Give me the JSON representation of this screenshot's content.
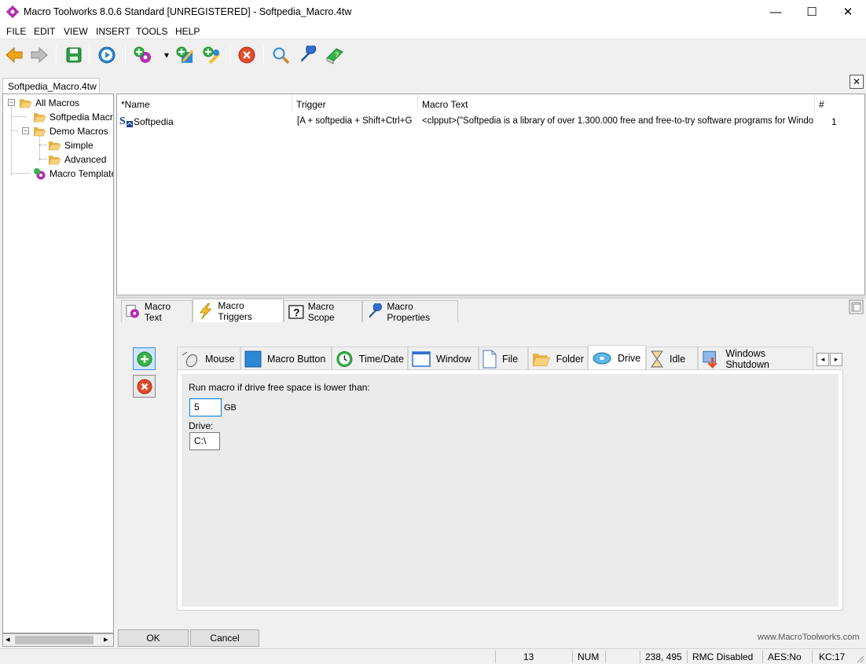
{
  "window": {
    "title": "Macro Toolworks 8.0.6 Standard [UNREGISTERED] - Softpedia_Macro.4tw",
    "minimize_glyph": "—",
    "maximize_glyph": "☐",
    "close_glyph": "✕"
  },
  "menu": [
    "FILE",
    "EDIT",
    "VIEW",
    "INSERT",
    "TOOLS",
    "HELP"
  ],
  "toolbar": {
    "icons": [
      "back-arrow-icon",
      "forward-arrow-icon",
      "save-icon",
      "play-icon",
      "new-macro-icon",
      "dropdown-icon",
      "edit-macro-icon",
      "copy-macro-icon",
      "delete-icon",
      "search-icon",
      "wrench-icon",
      "book-icon"
    ],
    "dropdown_glyph": "▾"
  },
  "document_tab": {
    "label": "Softpedia_Macro.4tw",
    "close_glyph": "✕"
  },
  "tree": {
    "items": [
      {
        "label": "All Macros"
      },
      {
        "label": "Softpedia Macros"
      },
      {
        "label": "Demo Macros"
      },
      {
        "label": "Simple"
      },
      {
        "label": "Advanced"
      },
      {
        "label": "Macro Templates"
      }
    ],
    "collapse_glyph": "−"
  },
  "tree_scroll": {
    "left": "◂",
    "right": "▸"
  },
  "macro_list": {
    "columns": [
      "*Name",
      "Trigger",
      "Macro Text",
      "#"
    ],
    "rows": [
      {
        "name": "Softpedia",
        "trigger": "[A + softpedia + Shift+Ctrl+G ...",
        "text": "<clpput>(\"Softpedia is a library of over 1.300.000 free and free-to-try software programs for Windows a...",
        "count": "1"
      }
    ]
  },
  "main_tabs": [
    "Macro Text",
    "Macro Triggers",
    "Macro Scope",
    "Macro Properties"
  ],
  "active_main_tab": "Macro Triggers",
  "trigger_tabs": [
    "Mouse",
    "Macro Button",
    "Time/Date",
    "Window",
    "File",
    "Folder",
    "Drive",
    "Idle",
    "Windows Shutdown"
  ],
  "active_trigger_tab": "Drive",
  "trigger_scroll": {
    "left": "◂",
    "right": "▸"
  },
  "drive_trigger": {
    "prompt": "Run macro if drive free space is lower than:",
    "size_value": "5",
    "size_unit": "GB",
    "drive_label": "Drive:",
    "drive_value": "C:\\"
  },
  "buttons": {
    "ok": "OK",
    "cancel": "Cancel"
  },
  "website": "www.MacroToolworks.com",
  "statusbar": {
    "count": "13",
    "num": "NUM",
    "coords": "238, 495",
    "rmc": "RMC Disabled",
    "aes": "AES:No",
    "kc": "KC:17"
  }
}
